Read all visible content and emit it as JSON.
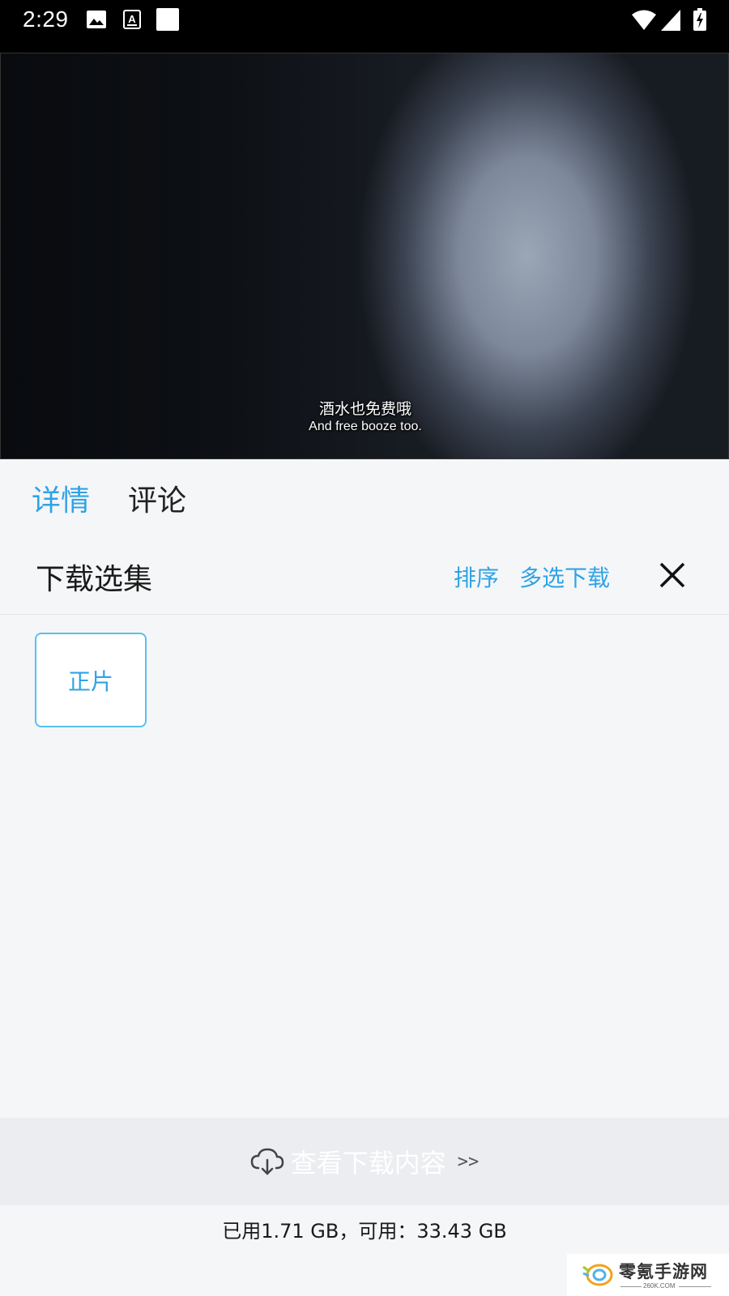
{
  "status_bar": {
    "time": "2:29"
  },
  "video": {
    "subtitle_cn": "酒水也免费哦",
    "subtitle_en": "And free booze too."
  },
  "tabs": [
    {
      "label": "详情",
      "active": true
    },
    {
      "label": "评论",
      "active": false
    }
  ],
  "download": {
    "title": "下载选集",
    "sort_label": "排序",
    "multi_label": "多选下载",
    "episodes": [
      {
        "label": "正片"
      }
    ]
  },
  "view_downloads": {
    "label": "查看下载内容",
    "arrow": ">>"
  },
  "storage": {
    "text": "已用1.71 GB，可用：33.43 GB"
  },
  "watermark": {
    "name": "零氪手游网",
    "url": "260K.COM"
  },
  "colors": {
    "accent": "#2fa3e6",
    "background": "#f5f6f8",
    "status_bar": "#000000"
  },
  "icons": [
    "image-icon",
    "font-icon",
    "notification-icon",
    "wifi-icon",
    "cellular-icon",
    "battery-icon",
    "close-icon",
    "cloud-download-icon"
  ]
}
